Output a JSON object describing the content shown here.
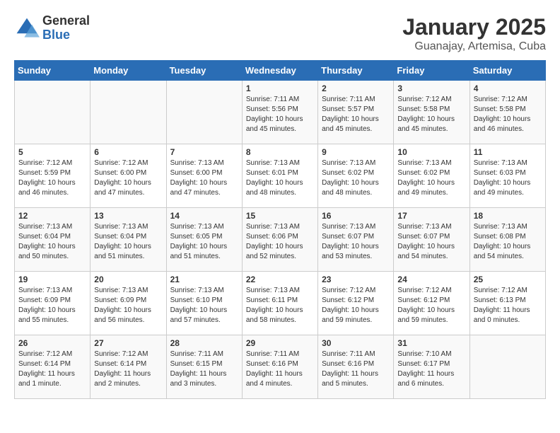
{
  "logo": {
    "general": "General",
    "blue": "Blue"
  },
  "title": "January 2025",
  "location": "Guanajay, Artemisa, Cuba",
  "days_of_week": [
    "Sunday",
    "Monday",
    "Tuesday",
    "Wednesday",
    "Thursday",
    "Friday",
    "Saturday"
  ],
  "weeks": [
    [
      {
        "day": "",
        "info": ""
      },
      {
        "day": "",
        "info": ""
      },
      {
        "day": "",
        "info": ""
      },
      {
        "day": "1",
        "info": "Sunrise: 7:11 AM\nSunset: 5:56 PM\nDaylight: 10 hours\nand 45 minutes."
      },
      {
        "day": "2",
        "info": "Sunrise: 7:11 AM\nSunset: 5:57 PM\nDaylight: 10 hours\nand 45 minutes."
      },
      {
        "day": "3",
        "info": "Sunrise: 7:12 AM\nSunset: 5:58 PM\nDaylight: 10 hours\nand 45 minutes."
      },
      {
        "day": "4",
        "info": "Sunrise: 7:12 AM\nSunset: 5:58 PM\nDaylight: 10 hours\nand 46 minutes."
      }
    ],
    [
      {
        "day": "5",
        "info": "Sunrise: 7:12 AM\nSunset: 5:59 PM\nDaylight: 10 hours\nand 46 minutes."
      },
      {
        "day": "6",
        "info": "Sunrise: 7:12 AM\nSunset: 6:00 PM\nDaylight: 10 hours\nand 47 minutes."
      },
      {
        "day": "7",
        "info": "Sunrise: 7:13 AM\nSunset: 6:00 PM\nDaylight: 10 hours\nand 47 minutes."
      },
      {
        "day": "8",
        "info": "Sunrise: 7:13 AM\nSunset: 6:01 PM\nDaylight: 10 hours\nand 48 minutes."
      },
      {
        "day": "9",
        "info": "Sunrise: 7:13 AM\nSunset: 6:02 PM\nDaylight: 10 hours\nand 48 minutes."
      },
      {
        "day": "10",
        "info": "Sunrise: 7:13 AM\nSunset: 6:02 PM\nDaylight: 10 hours\nand 49 minutes."
      },
      {
        "day": "11",
        "info": "Sunrise: 7:13 AM\nSunset: 6:03 PM\nDaylight: 10 hours\nand 49 minutes."
      }
    ],
    [
      {
        "day": "12",
        "info": "Sunrise: 7:13 AM\nSunset: 6:04 PM\nDaylight: 10 hours\nand 50 minutes."
      },
      {
        "day": "13",
        "info": "Sunrise: 7:13 AM\nSunset: 6:04 PM\nDaylight: 10 hours\nand 51 minutes."
      },
      {
        "day": "14",
        "info": "Sunrise: 7:13 AM\nSunset: 6:05 PM\nDaylight: 10 hours\nand 51 minutes."
      },
      {
        "day": "15",
        "info": "Sunrise: 7:13 AM\nSunset: 6:06 PM\nDaylight: 10 hours\nand 52 minutes."
      },
      {
        "day": "16",
        "info": "Sunrise: 7:13 AM\nSunset: 6:07 PM\nDaylight: 10 hours\nand 53 minutes."
      },
      {
        "day": "17",
        "info": "Sunrise: 7:13 AM\nSunset: 6:07 PM\nDaylight: 10 hours\nand 54 minutes."
      },
      {
        "day": "18",
        "info": "Sunrise: 7:13 AM\nSunset: 6:08 PM\nDaylight: 10 hours\nand 54 minutes."
      }
    ],
    [
      {
        "day": "19",
        "info": "Sunrise: 7:13 AM\nSunset: 6:09 PM\nDaylight: 10 hours\nand 55 minutes."
      },
      {
        "day": "20",
        "info": "Sunrise: 7:13 AM\nSunset: 6:09 PM\nDaylight: 10 hours\nand 56 minutes."
      },
      {
        "day": "21",
        "info": "Sunrise: 7:13 AM\nSunset: 6:10 PM\nDaylight: 10 hours\nand 57 minutes."
      },
      {
        "day": "22",
        "info": "Sunrise: 7:13 AM\nSunset: 6:11 PM\nDaylight: 10 hours\nand 58 minutes."
      },
      {
        "day": "23",
        "info": "Sunrise: 7:12 AM\nSunset: 6:12 PM\nDaylight: 10 hours\nand 59 minutes."
      },
      {
        "day": "24",
        "info": "Sunrise: 7:12 AM\nSunset: 6:12 PM\nDaylight: 10 hours\nand 59 minutes."
      },
      {
        "day": "25",
        "info": "Sunrise: 7:12 AM\nSunset: 6:13 PM\nDaylight: 11 hours\nand 0 minutes."
      }
    ],
    [
      {
        "day": "26",
        "info": "Sunrise: 7:12 AM\nSunset: 6:14 PM\nDaylight: 11 hours\nand 1 minute."
      },
      {
        "day": "27",
        "info": "Sunrise: 7:12 AM\nSunset: 6:14 PM\nDaylight: 11 hours\nand 2 minutes."
      },
      {
        "day": "28",
        "info": "Sunrise: 7:11 AM\nSunset: 6:15 PM\nDaylight: 11 hours\nand 3 minutes."
      },
      {
        "day": "29",
        "info": "Sunrise: 7:11 AM\nSunset: 6:16 PM\nDaylight: 11 hours\nand 4 minutes."
      },
      {
        "day": "30",
        "info": "Sunrise: 7:11 AM\nSunset: 6:16 PM\nDaylight: 11 hours\nand 5 minutes."
      },
      {
        "day": "31",
        "info": "Sunrise: 7:10 AM\nSunset: 6:17 PM\nDaylight: 11 hours\nand 6 minutes."
      },
      {
        "day": "",
        "info": ""
      }
    ]
  ]
}
